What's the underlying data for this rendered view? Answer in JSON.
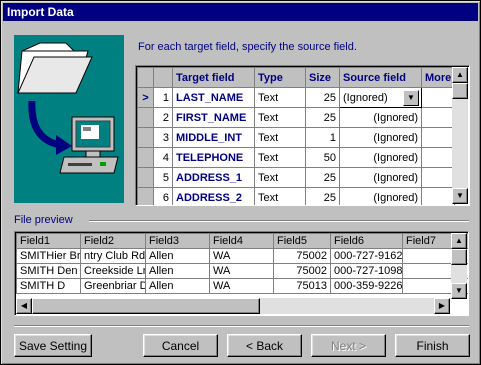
{
  "window": {
    "title": "Import Data"
  },
  "instruction": "For each target field, specify the source field.",
  "mapping": {
    "columns": [
      "Target field",
      "Type",
      "Size",
      "Source field",
      "More"
    ],
    "rows": [
      {
        "num": "1",
        "target": "LAST_NAME",
        "type": "Text",
        "size": "25",
        "source": "(Ignored)"
      },
      {
        "num": "2",
        "target": "FIRST_NAME",
        "type": "Text",
        "size": "25",
        "source": "(Ignored)"
      },
      {
        "num": "3",
        "target": "MIDDLE_INT",
        "type": "Text",
        "size": "1",
        "source": "(Ignored)"
      },
      {
        "num": "4",
        "target": "TELEPHONE",
        "type": "Text",
        "size": "50",
        "source": "(Ignored)"
      },
      {
        "num": "5",
        "target": "ADDRESS_1",
        "type": "Text",
        "size": "25",
        "source": "(Ignored)"
      },
      {
        "num": "6",
        "target": "ADDRESS_2",
        "type": "Text",
        "size": "25",
        "source": "(Ignored)"
      }
    ],
    "current_row_marker": ">"
  },
  "preview": {
    "label": "File preview",
    "columns": [
      "Field1",
      "Field2",
      "Field3",
      "Field4",
      "Field5",
      "Field6",
      "Field7"
    ],
    "rows": [
      [
        "SMITHier Br",
        "ntry Club Rd",
        "Allen",
        "WA",
        "75002",
        "000-727-9162",
        ""
      ],
      [
        "SMITH Den",
        "Creekside Ln",
        "Allen",
        "WA",
        "75002",
        "000-727-1098",
        ""
      ],
      [
        "SMITH D",
        "Greenbriar Dr",
        "Allen",
        "WA",
        "75013",
        "000-359-9226",
        ""
      ]
    ]
  },
  "buttons": {
    "save_setting": "Save Setting",
    "cancel": "Cancel",
    "back": "< Back",
    "next": "Next >",
    "finish": "Finish"
  }
}
